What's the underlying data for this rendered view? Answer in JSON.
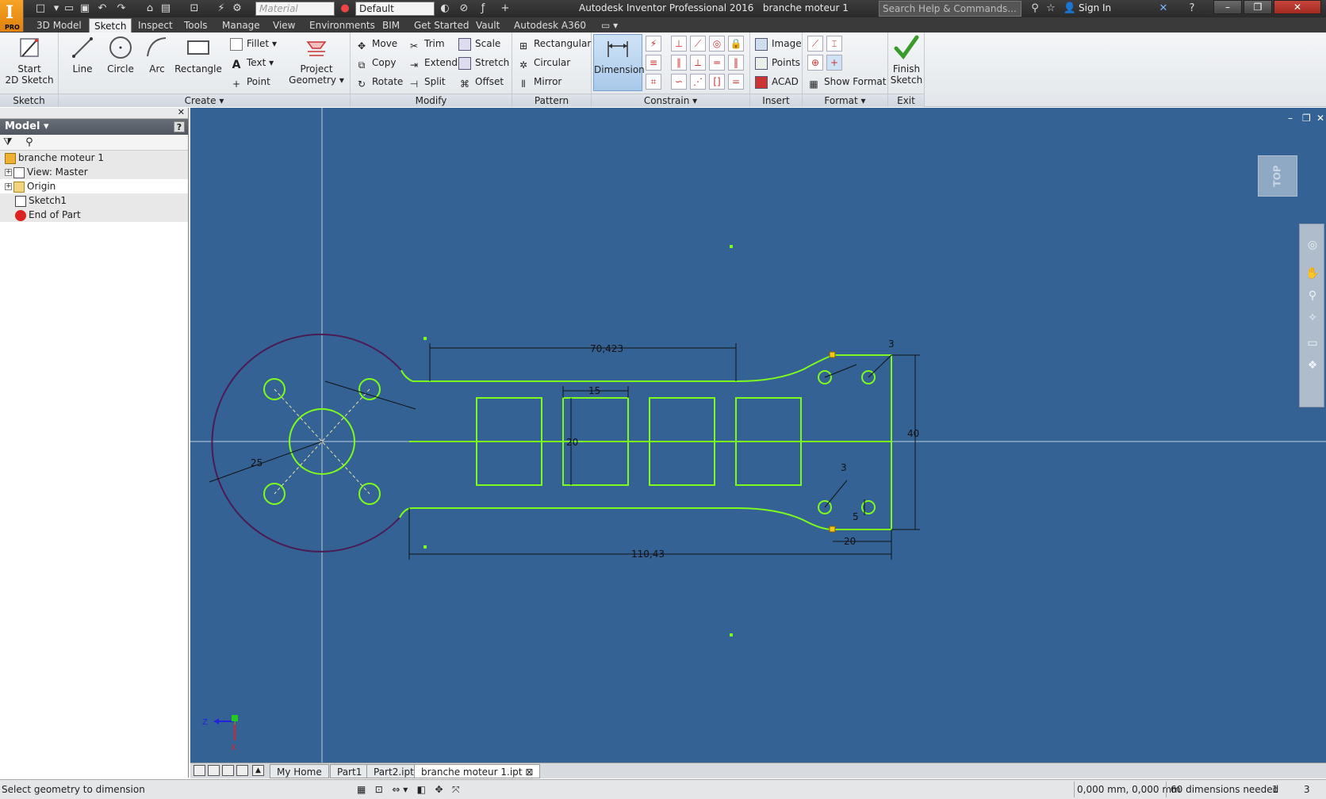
{
  "app": {
    "title": "Autodesk Inventor Professional 2016",
    "document": "branche moteur 1",
    "logo_badge": "PRO"
  },
  "quick_access": {
    "material_placeholder": "Material",
    "appearance": "Default",
    "search_placeholder": "Search Help & Commands...",
    "sign_in": "Sign In"
  },
  "tabs": [
    {
      "label": "3D Model"
    },
    {
      "label": "Sketch"
    },
    {
      "label": "Inspect"
    },
    {
      "label": "Tools"
    },
    {
      "label": "Manage"
    },
    {
      "label": "View"
    },
    {
      "label": "Environments"
    },
    {
      "label": "BIM"
    },
    {
      "label": "Get Started"
    },
    {
      "label": "Vault"
    },
    {
      "label": "Autodesk A360"
    }
  ],
  "ribbon": {
    "sketch_panel": {
      "title": "Sketch",
      "start_line1": "Start",
      "start_line2": "2D Sketch"
    },
    "create_panel": {
      "title": "Create",
      "line": "Line",
      "circle": "Circle",
      "arc": "Arc",
      "rectangle": "Rectangle",
      "fillet": "Fillet",
      "text": "Text",
      "point": "Point",
      "project_line1": "Project",
      "project_line2": "Geometry"
    },
    "modify_panel": {
      "title": "Modify",
      "move": "Move",
      "copy": "Copy",
      "rotate": "Rotate",
      "trim": "Trim",
      "extend": "Extend",
      "split": "Split",
      "scale": "Scale",
      "stretch": "Stretch",
      "offset": "Offset"
    },
    "pattern_panel": {
      "title": "Pattern",
      "rectangular": "Rectangular",
      "circular": "Circular",
      "mirror": "Mirror"
    },
    "constrain_panel": {
      "title": "Constrain",
      "dimension": "Dimension"
    },
    "insert_panel": {
      "title": "Insert",
      "image": "Image",
      "points": "Points",
      "acad": "ACAD"
    },
    "format_panel": {
      "title": "Format",
      "show_format": "Show Format"
    },
    "exit_panel": {
      "title": "Exit",
      "finish_line1": "Finish",
      "finish_line2": "Sketch"
    }
  },
  "browser": {
    "title": "Model",
    "help": "?",
    "tree": [
      {
        "label": "branche moteur 1"
      },
      {
        "label": "View: Master"
      },
      {
        "label": "Origin"
      },
      {
        "label": "Sketch1"
      },
      {
        "label": "End of Part"
      }
    ]
  },
  "viewport": {
    "viewcube_label": "TOP",
    "dimensions": {
      "top_length": "70,423",
      "slot_width": "15",
      "slot_height": "20",
      "radius": "25",
      "total_length": "110,43",
      "end_width": "20",
      "height": "40",
      "hole_offset_top": "3",
      "hole_offset_bottom": "3",
      "hole_spacing": "5"
    },
    "triad": {
      "x": "X",
      "y": "Y",
      "z": "Z"
    }
  },
  "doc_tabs": [
    {
      "label": "My Home"
    },
    {
      "label": "Part1"
    },
    {
      "label": "Part2.ipt"
    },
    {
      "label": "branche moteur 1.ipt"
    }
  ],
  "status": {
    "prompt": "Select geometry to dimension",
    "coords": "0,000 mm, 0,000 mm",
    "dims_needed": "60 dimensions needed",
    "count1": "1",
    "count2": "3"
  },
  "colors": {
    "viewport_bg": "#356295",
    "sketch_green": "#7cfc1a",
    "arc_purple": "#4a1c52",
    "ribbon_bg": "#eef1f4"
  }
}
